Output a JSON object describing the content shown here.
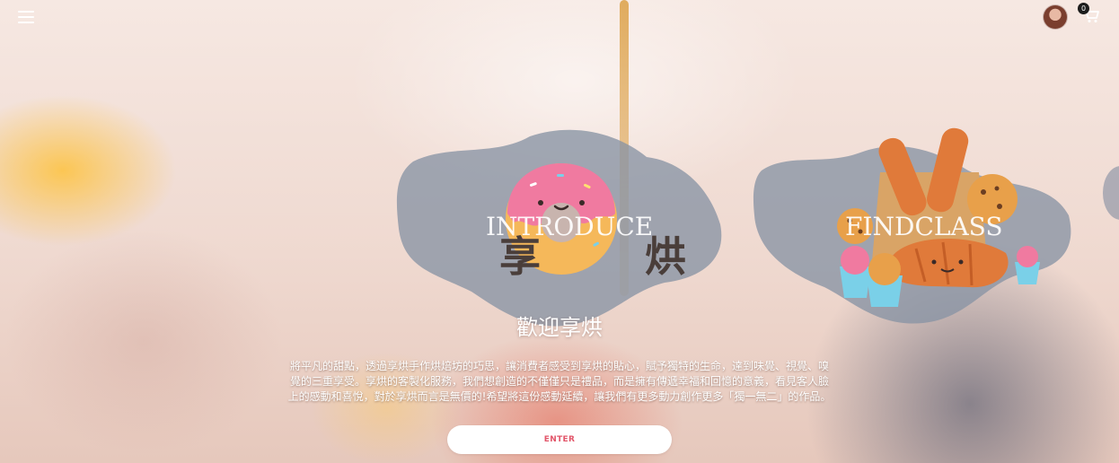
{
  "header": {
    "menu_icon": "hamburger-menu-icon",
    "avatar_icon": "user-avatar",
    "cart_icon": "shopping-cart-icon",
    "cart_count": "0"
  },
  "cards": [
    {
      "title": "INTRODUCE",
      "subtitle": "享 烘",
      "icon": "donut-illustration"
    },
    {
      "title": "FINDCLASS",
      "subtitle": "",
      "icon": "bread-and-cupcakes-illustration"
    }
  ],
  "main": {
    "heading": "歡迎享烘",
    "paragraph": "將平凡的甜點，透過享烘手作烘焙坊的巧思，讓消費者感受到享烘的貼心，賦予獨特的生命，達到味覺、視覺、嗅覺的三重享受。享烘的客製化服務，我們想創造的不僅僅只是禮品，而是擁有傳遞幸福和回憶的意義，看見客人臉上的感動和喜悅，對於享烘而言是無價的!希望將這份感動延續，讓我們有更多動力創作更多「獨一無二」的作品。",
    "enter_label": "ENTER"
  },
  "colors": {
    "blob": "#8893a4",
    "enter_text": "#e2566a",
    "donut_frosting": "#f07aa0",
    "donut_dough": "#f5b85a"
  }
}
